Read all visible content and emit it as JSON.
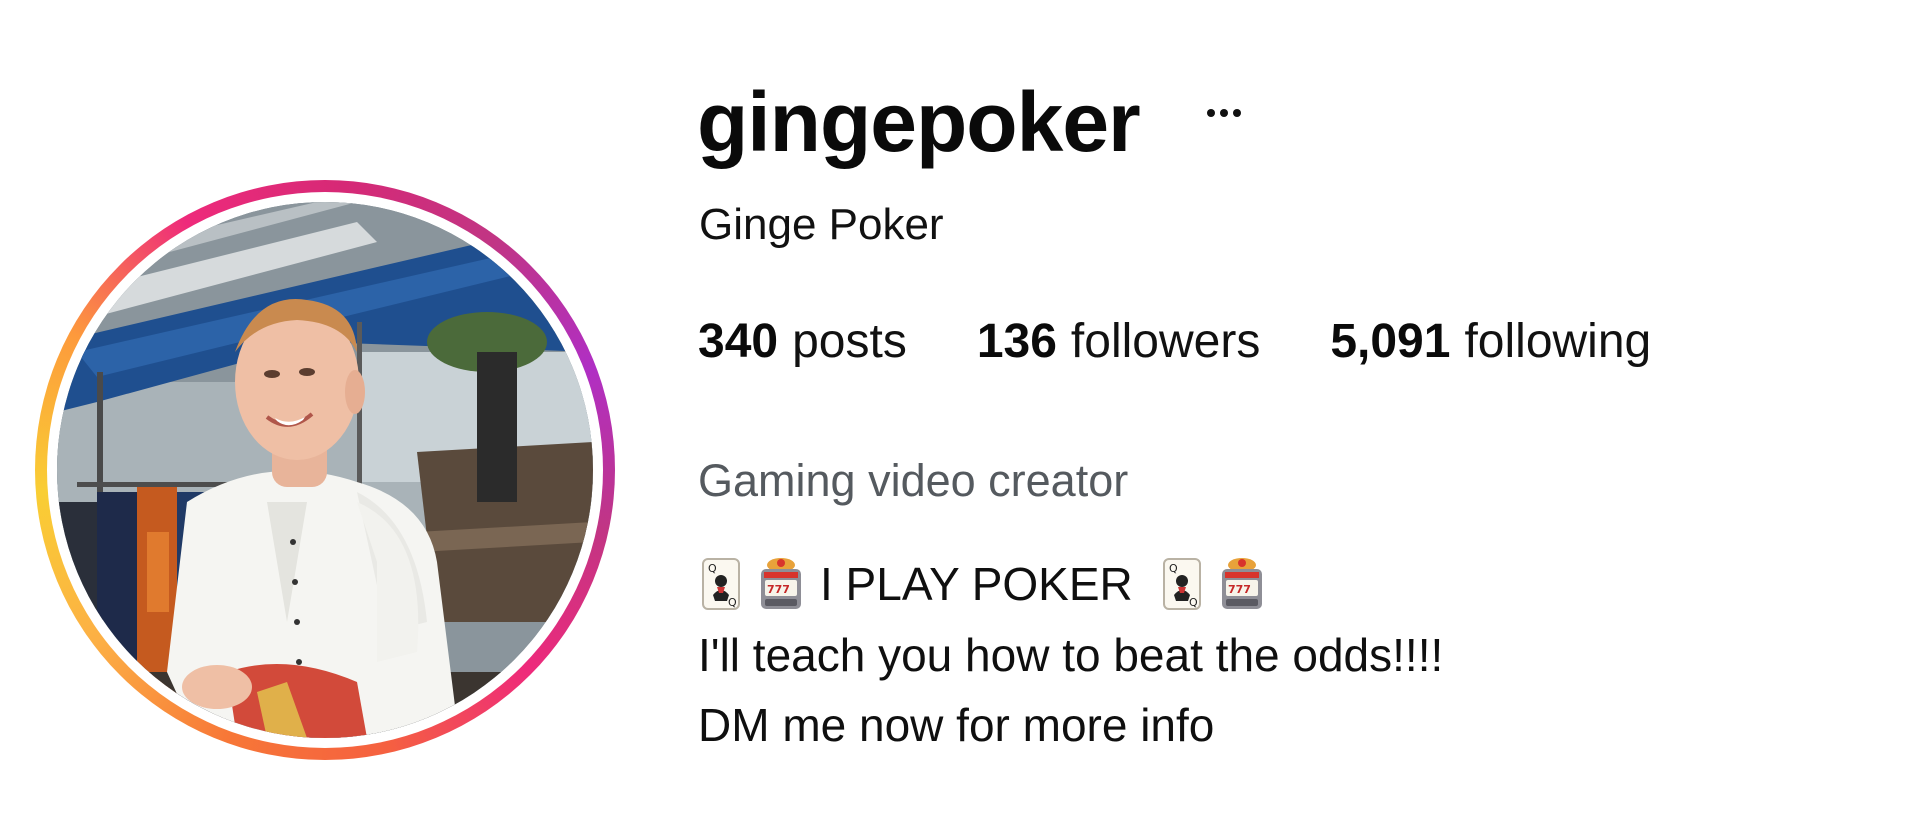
{
  "profile": {
    "username": "gingepoker",
    "more_icon": "more-horizontal-icon",
    "display_name": "Ginge Poker",
    "stats": [
      {
        "value": "340",
        "label": "posts"
      },
      {
        "value": "136",
        "label": "followers"
      },
      {
        "value": "5,091",
        "label": "following"
      }
    ],
    "category": "Gaming video creator",
    "bio": {
      "headline": "I PLAY POKER",
      "headline_emojis_before": [
        "playing-card-icon",
        "slot-machine-icon"
      ],
      "headline_emojis_after": [
        "playing-card-icon",
        "slot-machine-icon"
      ],
      "line2": "I'll teach you how to beat the odds!!!!",
      "line3": "DM me now for more info"
    },
    "avatar_ring_colors": [
      "#f77737",
      "#fcaf45",
      "#ee2a7b",
      "#c13584",
      "#b02fc4"
    ]
  }
}
